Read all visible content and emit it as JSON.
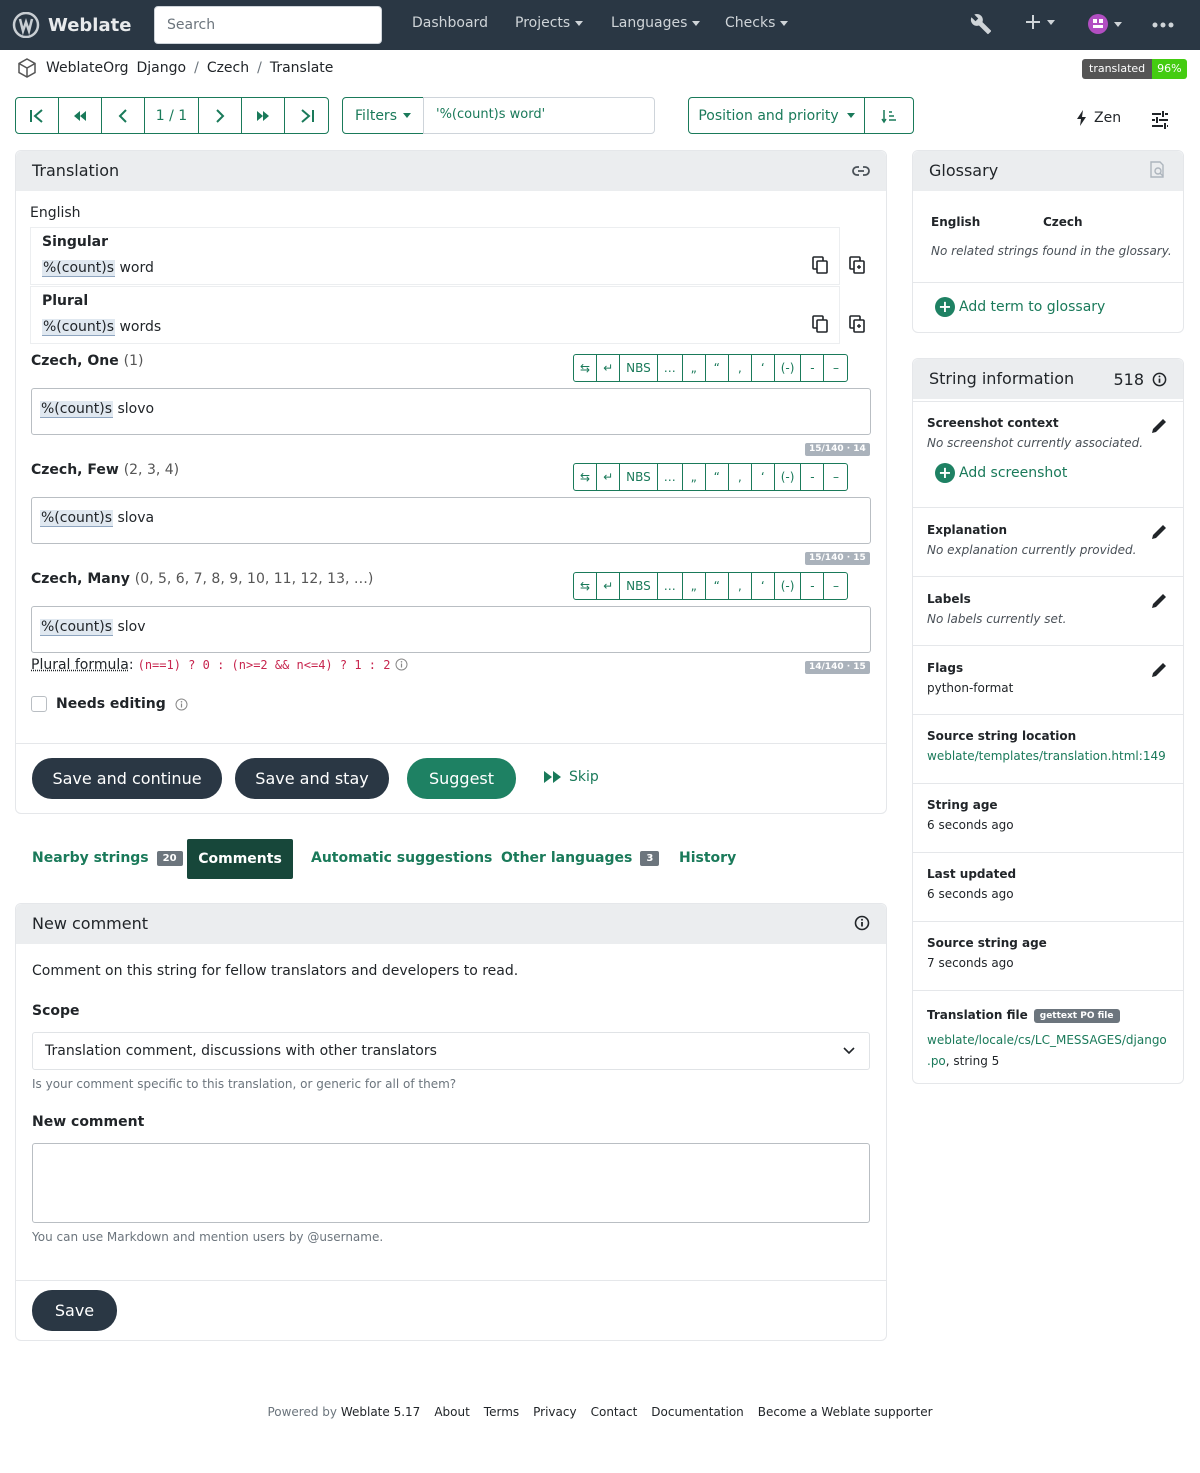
{
  "navbar": {
    "brand": "Weblate",
    "search_placeholder": "Search",
    "items": [
      {
        "label": "Dashboard"
      },
      {
        "label": "Projects"
      },
      {
        "label": "Languages"
      },
      {
        "label": "Checks"
      }
    ],
    "icons": [
      "wrench-icon",
      "plus-icon",
      "avatar-icon",
      "more-icon"
    ]
  },
  "breadcrumb": {
    "items": [
      "WeblateOrg",
      "Django",
      "Czech",
      "Translate"
    ],
    "badge_label": "translated",
    "badge_value": "96%"
  },
  "toolbar": {
    "counter": "1 / 1",
    "filters_label": "Filters",
    "query": "'%(count)s word'",
    "sort_label": "Position and priority",
    "zen_label": "Zen"
  },
  "translation": {
    "title": "Translation",
    "source_language": "English",
    "sources": [
      {
        "form": "Singular",
        "placeholder": "%(count)s",
        "text": " word"
      },
      {
        "form": "Plural",
        "placeholder": "%(count)s",
        "text": " words"
      }
    ],
    "targets": [
      {
        "label": "Czech, One",
        "numbers": "(1)",
        "placeholder": "%(count)s",
        "text": " slovo",
        "length": "15/140 · 14"
      },
      {
        "label": "Czech, Few",
        "numbers": "(2, 3, 4)",
        "placeholder": "%(count)s",
        "text": " slova",
        "length": "15/140 · 15"
      },
      {
        "label": "Czech, Many",
        "numbers": "(0, 5, 6, 7, 8, 9, 10, 11, 12, 13, …)",
        "placeholder": "%(count)s",
        "text": " slov",
        "length": "14/140 · 15"
      }
    ],
    "special_chars": [
      "⇆",
      "↵",
      "NBS",
      "…",
      "„",
      "“",
      "‚",
      "‘",
      "(-)",
      "-",
      "–"
    ],
    "plural_label": "Plural formula",
    "plural_formula": "(n==1) ? 0 : (n>=2 && n<=4) ? 1 : 2",
    "needs_editing": "Needs editing",
    "buttons": {
      "save_continue": "Save and continue",
      "save_stay": "Save and stay",
      "suggest": "Suggest",
      "skip": "Skip"
    }
  },
  "tabs": [
    {
      "label": "Nearby strings",
      "count": "20"
    },
    {
      "label": "Comments"
    },
    {
      "label": "Automatic suggestions"
    },
    {
      "label": "Other languages",
      "count": "3"
    },
    {
      "label": "History"
    }
  ],
  "comment": {
    "title": "New comment",
    "intro": "Comment on this string for fellow translators and developers to read.",
    "scope_label": "Scope",
    "scope_value": "Translation comment, discussions with other translators",
    "scope_help": "Is your comment specific to this translation, or generic for all of them?",
    "new_label": "New comment",
    "new_help": "You can use Markdown and mention users by @username.",
    "save": "Save"
  },
  "glossary": {
    "title": "Glossary",
    "col_source": "English",
    "col_target": "Czech",
    "empty": "No related strings found in the glossary.",
    "add": "Add term to glossary"
  },
  "string_info": {
    "title": "String information",
    "id": "518",
    "screenshot_title": "Screenshot context",
    "screenshot_value": "No screenshot currently associated.",
    "screenshot_add": "Add screenshot",
    "explanation_title": "Explanation",
    "explanation_value": "No explanation currently provided.",
    "labels_title": "Labels",
    "labels_value": "No labels currently set.",
    "flags_title": "Flags",
    "flags_value": "python-format",
    "location_title": "Source string location",
    "location_value": "weblate/templates/translation.html:149",
    "age_title": "String age",
    "age_value": "6 seconds ago",
    "updated_title": "Last updated",
    "updated_value": "6 seconds ago",
    "source_age_title": "Source string age",
    "source_age_value": "7 seconds ago",
    "file_title": "Translation file",
    "file_badge": "gettext PO file",
    "file_path_1": "weblate/locale/cs/LC_MESSAGES/django",
    "file_path_2": ".po",
    "file_suffix": ", string 5"
  },
  "footer": {
    "powered": "Powered by",
    "version": "Weblate 5.17",
    "links": [
      "About",
      "Terms",
      "Privacy",
      "Contact",
      "Documentation",
      "Become a Weblate supporter"
    ]
  },
  "colors": {
    "navbar": "#2a3744",
    "accent": "#1a7a5a",
    "suggest": "#1e8163",
    "active_tab": "#17473a"
  }
}
